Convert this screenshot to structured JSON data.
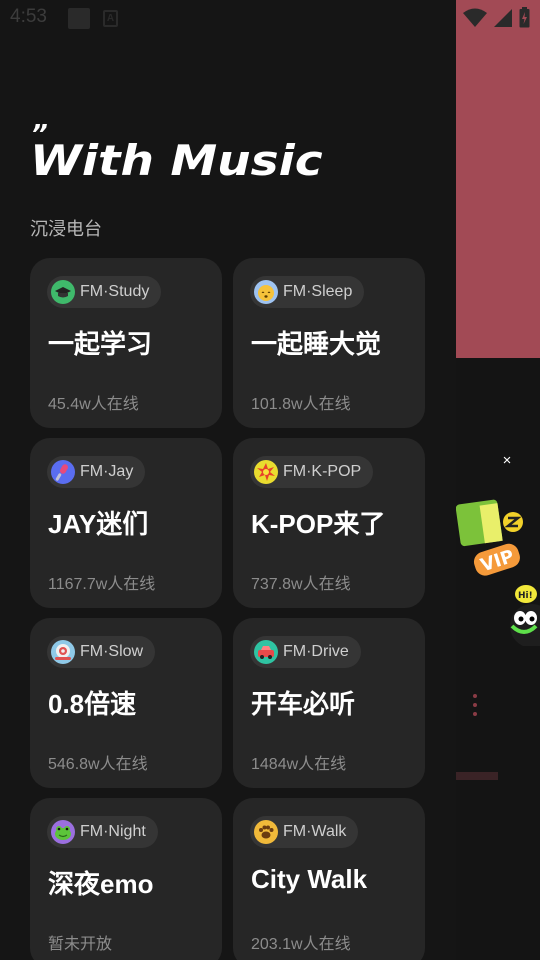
{
  "status_bar": {
    "time": "4:53",
    "notification_icons": [
      "square-icon",
      "a-icon"
    ],
    "system_icons": [
      "wifi-icon",
      "signal-icon",
      "battery-icon"
    ]
  },
  "header": {
    "quote_mark": "”",
    "title": "With Music",
    "section": "沉浸电台"
  },
  "cards": [
    {
      "tag": "FM·Study",
      "icon": "graduation-cap-icon",
      "icon_color": "#3fb96b",
      "title": "一起学习",
      "listeners": "45.4w人在线"
    },
    {
      "tag": "FM·Sleep",
      "icon": "sleepy-face-icon",
      "icon_color": "#9fc3f0",
      "title": "一起睡大觉",
      "listeners": "101.8w人在线"
    },
    {
      "tag": "FM·Jay",
      "icon": "microphone-icon",
      "icon_color": "#5a6df0",
      "title": "JAY迷们",
      "listeners": "1167.7w人在线"
    },
    {
      "tag": "FM·K-POP",
      "icon": "explosion-icon",
      "icon_color": "#e9dc2f",
      "title": "K-POP来了",
      "listeners": "737.8w人在线"
    },
    {
      "tag": "FM·Slow",
      "icon": "snail-icon",
      "icon_color": "#8fc9e8",
      "title": "0.8倍速",
      "listeners": "546.8w人在线"
    },
    {
      "tag": "FM·Drive",
      "icon": "car-icon",
      "icon_color": "#2fc3a2",
      "title": "开车必听",
      "listeners": "1484w人在线"
    },
    {
      "tag": "FM·Night",
      "icon": "frog-icon",
      "icon_color": "#9b6fe0",
      "title": "深夜emo",
      "listeners": "暂未开放"
    },
    {
      "tag": "FM·Walk",
      "icon": "paw-icon",
      "icon_color": "#f0b93a",
      "title": "City Walk",
      "listeners": "203.1w人在线"
    }
  ],
  "background_app": {
    "close_label": "×",
    "accent_color": "#a24a55"
  }
}
